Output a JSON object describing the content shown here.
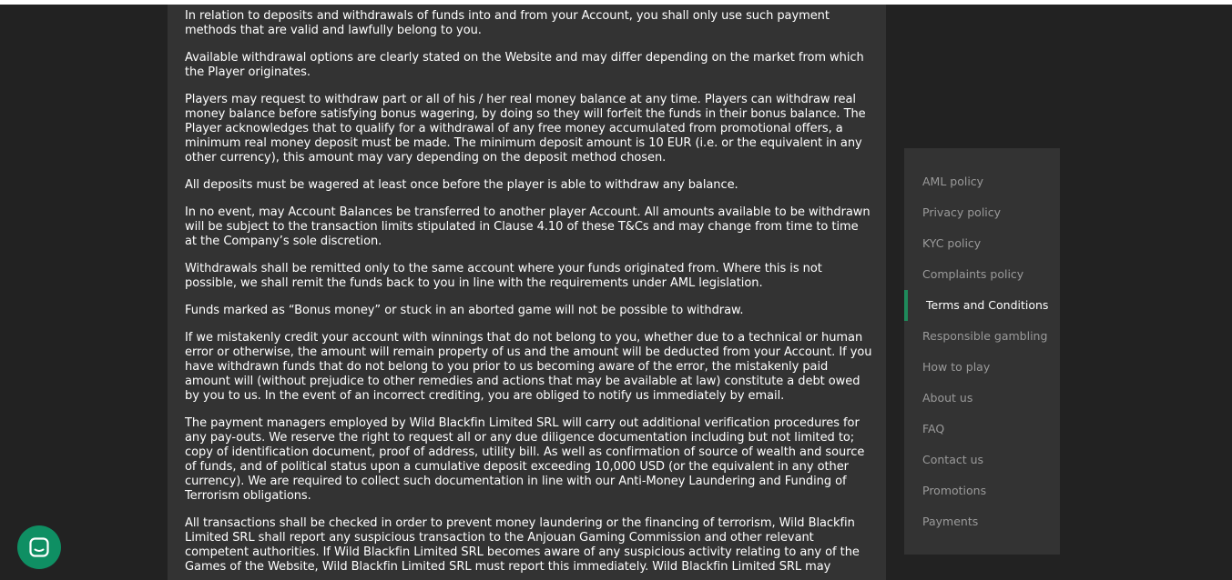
{
  "content": {
    "paragraphs": [
      "In relation to deposits and withdrawals of funds into and from your Account, you shall only use such payment methods that are valid and lawfully belong to you.",
      "Available withdrawal options are clearly stated on the Website and may differ depending on the market from which the Player originates.",
      "Players may request to withdraw part or all of his / her real money balance at any time. Players can withdraw real money balance before satisfying bonus wagering, by doing so they will forfeit the funds in their bonus balance. The Player acknowledges that to qualify for a withdrawal of any free money accumulated from promotional offers, a minimum real money deposit must be made. The minimum deposit amount is 10 EUR (i.e. or the equivalent in any other currency), this amount may vary depending on the deposit method chosen.",
      "All deposits must be wagered at least once before the player is able to withdraw any balance.",
      "In no event, may Account Balances be transferred to another player Account. All amounts available to be withdrawn will be subject to the transaction limits stipulated in Clause 4.10 of these T&Cs and may change from time to time at the Company’s sole discretion.",
      "Withdrawals shall be remitted only to the same account where your funds originated from. Where this is not possible, we shall remit the funds back to you in line with the requirements under AML legislation.",
      "Funds marked as “Bonus money” or stuck in an aborted game will not be possible to withdraw.",
      "If we mistakenly credit your account with winnings that do not belong to you, whether due to a technical or human error or otherwise, the amount will remain property of us and the amount will be deducted from your Account. If you have withdrawn funds that do not belong to you prior to us becoming aware of the error, the mistakenly paid amount will (without prejudice to other remedies and actions that may be available at law) constitute a debt owed by you to us. In the event of an incorrect crediting, you are obliged to notify us immediately by email.",
      "The payment managers employed by Wild Blackfin Limited SRL will carry out additional verification procedures for any pay-outs. We reserve the right to request all or any due diligence documentation including but not limited to; copy of identification document, proof of address, utility bill. As well as confirmation of source of wealth and source of funds, and of political status upon a cumulative deposit exceeding 10,000 USD (or the equivalent in any other currency). We are required to collect such documentation in line with our Anti-Money Laundering and Funding of Terrorism obligations.",
      "All transactions shall be checked in order to prevent money laundering or the financing of terrorism, Wild Blackfin Limited SRL shall report any suspicious transaction to the Anjouan Gaming Commission and other relevant competent authorities. If Wild Blackfin Limited SRL becomes aware of any suspicious activity relating to any of the Games of the Website, Wild Blackfin Limited SRL must report this immediately. Wild Blackfin Limited SRL may"
    ]
  },
  "side_nav": {
    "items": [
      {
        "label": "AML policy"
      },
      {
        "label": "Privacy policy"
      },
      {
        "label": "KYC policy"
      },
      {
        "label": "Complaints policy"
      },
      {
        "label": "Terms and Conditions"
      },
      {
        "label": "Responsible gambling"
      },
      {
        "label": "How to play"
      },
      {
        "label": "About us"
      },
      {
        "label": "FAQ"
      },
      {
        "label": "Contact us"
      },
      {
        "label": "Promotions"
      },
      {
        "label": "Payments"
      }
    ],
    "active_label": "Terms and Conditions"
  },
  "chat_widget": {
    "icon": "chat-bubble-icon"
  },
  "colors": {
    "page_background": "#222222",
    "panel_background": "#333333",
    "text": "#ffffff",
    "nav_text": "#9a9a9a",
    "accent": "#1f8a5b",
    "chat_button": "#0f8f63"
  }
}
